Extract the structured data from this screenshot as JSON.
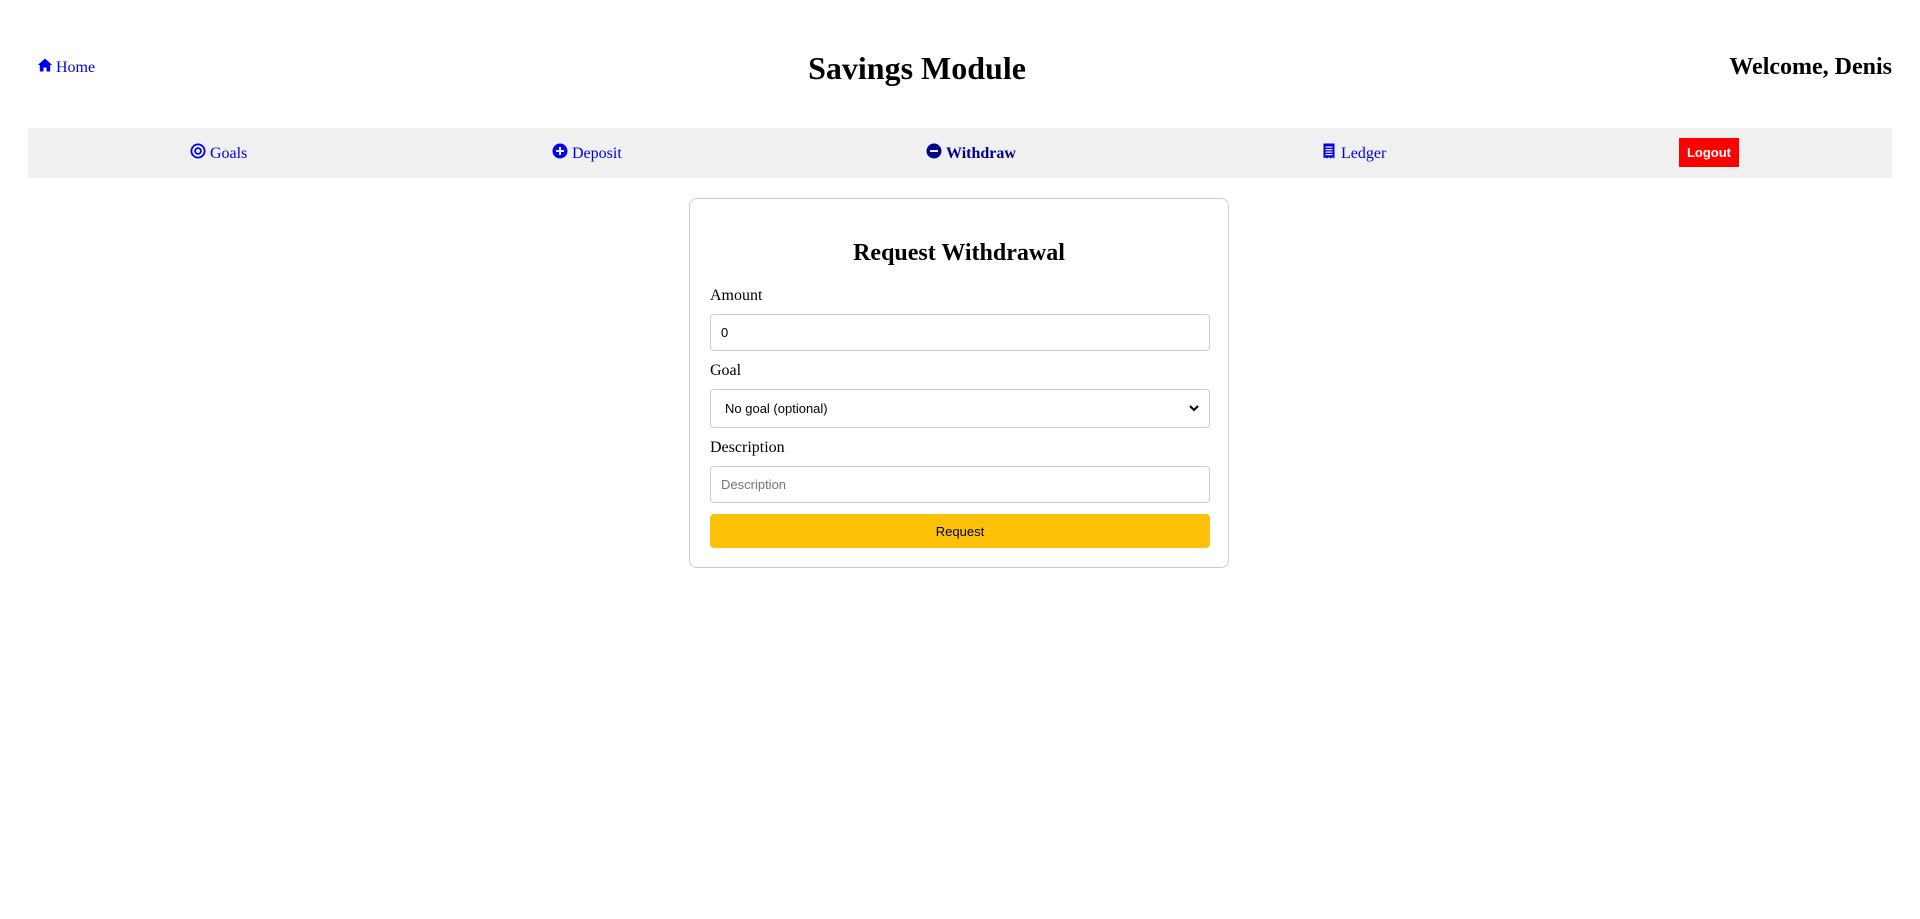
{
  "header": {
    "home_label": "Home",
    "title": "Savings Module",
    "welcome": "Welcome, Denis"
  },
  "nav": {
    "goals": "Goals",
    "deposit": "Deposit",
    "withdraw": "Withdraw",
    "ledger": "Ledger",
    "logout": "Logout",
    "active": "Withdraw"
  },
  "form": {
    "title": "Request Withdrawal",
    "amount_label": "Amount",
    "amount_value": "0",
    "goal_label": "Goal",
    "goal_selected": "No goal (optional)",
    "description_label": "Description",
    "description_placeholder": "Description",
    "submit_label": "Request"
  },
  "icons": {
    "home": "home-icon",
    "goals": "target-icon",
    "deposit": "plus-circle-icon",
    "withdraw": "minus-circle-icon",
    "ledger": "receipt-icon",
    "select": "chevron-down-icon"
  },
  "colors": {
    "link": "#0000ee",
    "active_link": "#00008b",
    "nav_background": "#f0f0f0",
    "logout": "#ff0000",
    "request_button": "#fdc107"
  }
}
